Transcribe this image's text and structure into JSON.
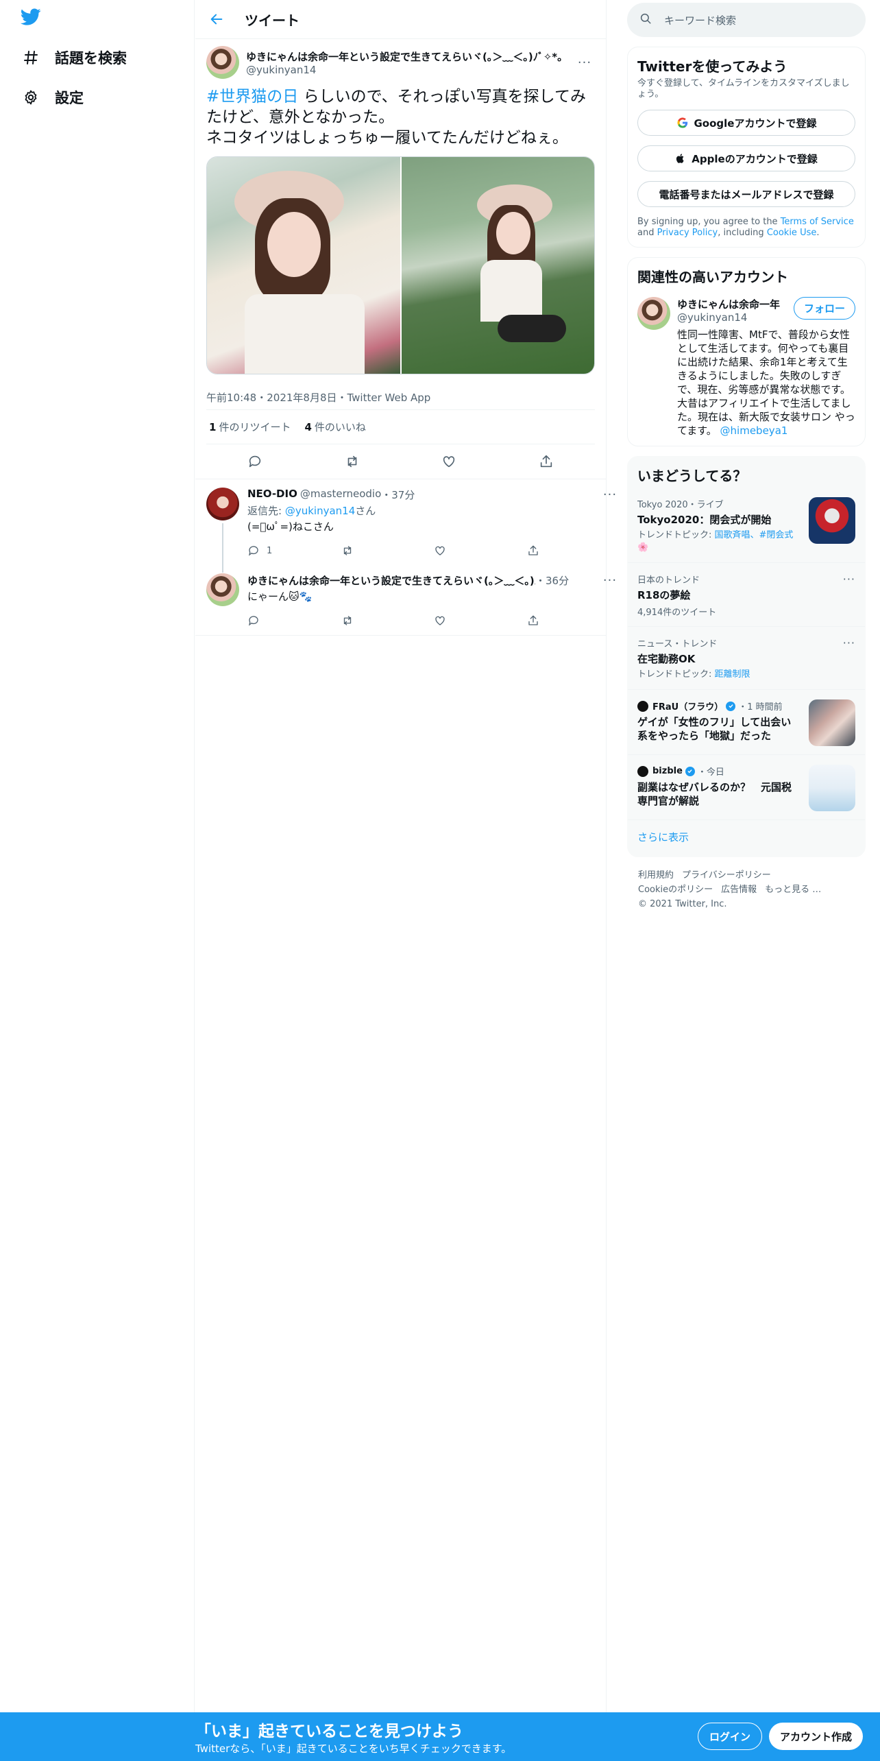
{
  "nav": {
    "logo": "twitter-bird-icon",
    "items": [
      {
        "label": "話題を検索",
        "icon": "hashtag-icon"
      },
      {
        "label": "設定",
        "icon": "gear-icon"
      }
    ]
  },
  "header": {
    "title": "ツイート"
  },
  "tweet": {
    "display_name": "ゆきにゃんは余命一年という設定で生きてえらいヾ(｡＞﹏＜｡)ﾉﾞ✧*。",
    "handle": "@yukinyan14",
    "hashtag": "#世界猫の日",
    "text_line1": " らしいので、それっぽい写真を探してみたけど、意外となかった。",
    "text_line2": "ネコタイツはしょっちゅー履いてたんだけどねぇ。",
    "meta": "午前10:48・2021年8月8日・Twitter Web App",
    "retweets_count": "1",
    "retweets_label": "件のリツイート",
    "likes_count": "4",
    "likes_label": "件のいいね"
  },
  "replies": [
    {
      "display_name": "NEO-DIO",
      "handle": "@masterneodio",
      "time": "・37分",
      "reply_to_prefix": "返信先: ",
      "reply_to_handle": "@yukinyan14",
      "reply_to_suffix": "さん",
      "text": "(=ﾟωﾟ=)ねこさん",
      "reply_count": "1"
    },
    {
      "display_name": "ゆきにゃんは余命一年という設定で生きてえらいヾ(｡＞﹏＜｡)ﾉ",
      "handle": "",
      "time": "・36分",
      "text": "にゃーん🐱🐾",
      "reply_count": ""
    }
  ],
  "search": {
    "placeholder": "キーワード検索"
  },
  "signup_panel": {
    "title": "Twitterを使ってみよう",
    "subtitle": "今すぐ登録して、タイムラインをカスタマイズしましょう。",
    "google": "Googleアカウントで登録",
    "apple": "Appleのアカウントで登録",
    "phone": "電話番号またはメールアドレスで登録",
    "terms_1": "By signing up, you agree to the ",
    "terms_link1": "Terms of Service",
    "terms_2": " and ",
    "terms_link2": "Privacy Policy",
    "terms_3": ", including ",
    "terms_link3": "Cookie Use",
    "terms_4": "."
  },
  "related": {
    "title": "関連性の高いアカウント",
    "name": "ゆきにゃんは余命一年",
    "handle": "@yukinyan14",
    "follow": "フォロー",
    "bio": "性同一性障害、MtFで、普段から女性として生活してます。何やっても裏目に出続けた結果、余命1年と考えて生きるようにしました。失敗のしすぎで、現在、劣等感が異常な状態です。大昔はアフィリエイトで生活してました。現在は、新大阪で女装サロン やってます。",
    "bio_link": "@himebeya1"
  },
  "trends": {
    "title": "いまどうしてる？",
    "items": [
      {
        "meta": "Tokyo 2020・ライブ",
        "title": "Tokyo2020：閉会式が開始",
        "topic_prefix": "トレンドトピック: ",
        "topic_links": "国歌斉唱、#閉会式",
        "topic_tail": "🌸"
      },
      {
        "meta": "日本のトレンド",
        "title": "R18の夢絵",
        "count": "4,914件のツイート"
      },
      {
        "meta": "ニュース・トレンド",
        "title": "在宅勤務OK",
        "topic_prefix": "トレンドトピック: ",
        "topic_links": "距離制限"
      },
      {
        "source": "FRaU（フラウ）",
        "time": "・1 時間前",
        "title": "ゲイが「女性のフリ」して出会い系をやったら「地獄」だった"
      },
      {
        "source": "bizble",
        "time": "・今日",
        "title": "副業はなぜバレるのか？　元国税専門官が解説"
      }
    ],
    "show_more": "さらに表示"
  },
  "footer": {
    "links1": [
      "利用規約",
      "プライバシーポリシー"
    ],
    "links2": [
      "Cookieのポリシー",
      "広告情報",
      "もっと見る …"
    ],
    "copyright": "© 2021 Twitter, Inc."
  },
  "bottom_bar": {
    "title": "「いま」起きていることを見つけよう",
    "subtitle": "Twitterなら、「いま」起きていることをいち早くチェックできます。",
    "login": "ログイン",
    "signup": "アカウント作成"
  },
  "colors": {
    "accent": "#1d9bf0",
    "text": "#0f1419",
    "muted": "#536471"
  }
}
